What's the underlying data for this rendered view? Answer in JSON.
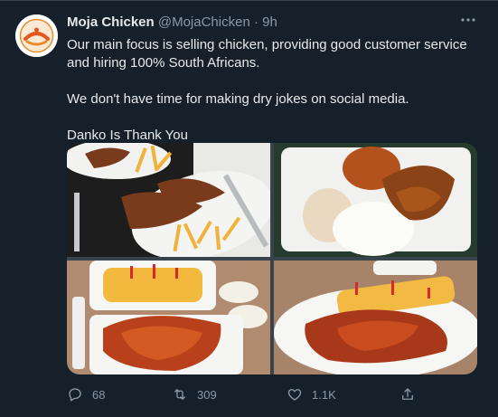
{
  "tweet": {
    "author": {
      "display_name": "Moja Chicken",
      "handle": "@MojaChicken",
      "separator": "·",
      "time": "9h",
      "avatar_logo_text": "Moja Chicken"
    },
    "text": {
      "paragraph_1": "Our main focus is selling chicken, providing good customer service and hiring 100% South Africans.",
      "paragraph_2": "We don't have time for making dry jokes on social media.",
      "paragraph_3": "Danko Is Thank You"
    },
    "actions": {
      "reply_count": "68",
      "retweet_count": "309",
      "like_count": "1.1K"
    },
    "more_icon": "more-horizontal-icon"
  },
  "colors": {
    "background": "#15202b",
    "text": "#e7e9ea",
    "secondary": "#8b98a5",
    "divider": "#38444d"
  }
}
